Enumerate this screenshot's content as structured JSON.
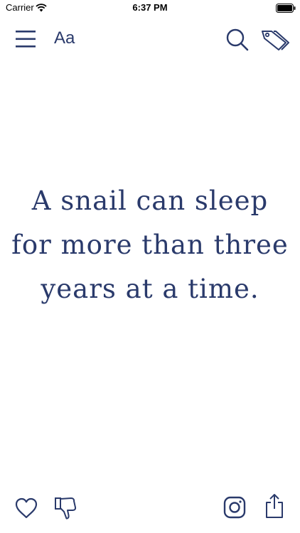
{
  "status_bar": {
    "carrier": "Carrier",
    "time": "6:37 PM"
  },
  "toolbar": {
    "font_button_label": "Aa"
  },
  "fact": {
    "text": "A snail can sleep for more than three years at a time."
  },
  "colors": {
    "ink": "#2a3a6b",
    "background": "#ffffff"
  },
  "icons": {
    "menu": "hamburger-menu-icon",
    "search": "search-icon",
    "tags": "tags-icon",
    "like": "heart-icon",
    "dislike": "thumbs-down-icon",
    "instagram": "instagram-icon",
    "share": "share-icon"
  }
}
